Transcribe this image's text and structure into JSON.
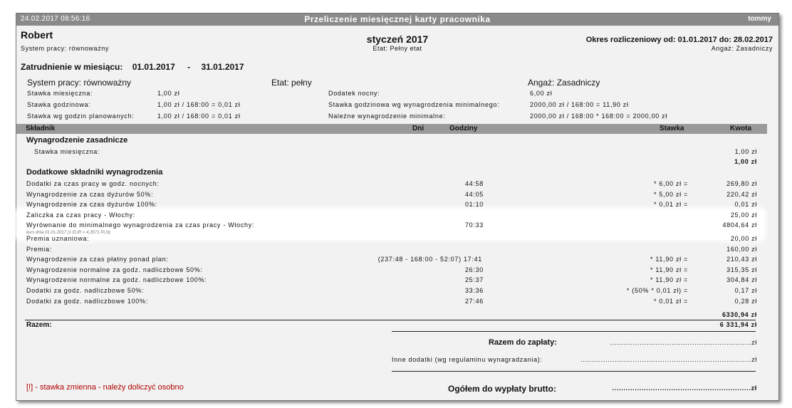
{
  "window": {
    "datetime": "24.02.2017  08:56:16",
    "title": "Przeliczenie miesięcznej karty pracownika",
    "user": "tommy"
  },
  "employee": {
    "name": "Robert",
    "system": "System pracy: równoważny",
    "month": "styczeń 2017",
    "etat": "Etat: Pełny etat",
    "period": "Okres rozliczeniowy od: 01.01.2017 do: 28.02.2017",
    "angaz": "Angaż: Zasadniczy"
  },
  "employment": {
    "label": "Zatrudnienie w miesiącu:",
    "from": "01.01.2017",
    "dash": "-",
    "to": "31.01.2017"
  },
  "params": {
    "system": "System pracy: równoważny",
    "etat": "Etat: pełny",
    "angaz": "Angaż: Zasadniczy",
    "stawka_mies_label": "Stawka miesięczna:",
    "stawka_mies_value": "1,00 zł",
    "stawka_godz_label": "Stawka godzinowa:",
    "stawka_godz_value": "1,00 zł / 168:00 = 0,01 zł",
    "stawka_plan_label": "Stawka wg godzin planowanych:",
    "stawka_plan_value": "1,00 zł / 168:00 = 0,01 zł",
    "dodatek_nocny_label": "Dodatek nocny:",
    "dodatek_nocny_value": "6,00 zł",
    "stawka_min_label": "Stawka godzinowa wg wynagrodzenia minimalnego:",
    "stawka_min_value": "2000,00 zł / 168:00 = 11,90 zł",
    "nalezne_min_label": "Należne wynagrodzenie minimalne:",
    "nalezne_min_value": "2000,00 zł / 168:00 * 168:00 = 2000,00 zł"
  },
  "table": {
    "headers": {
      "component": "Składnik",
      "days": "Dni",
      "hours": "Godziny",
      "rate": "Stawka",
      "amount": "Kwota"
    },
    "basic_title": "Wynagrodzenie zasadnicze",
    "basic_item_label": "Stawka miesięczna:",
    "basic_item_amount": "1,00 zł",
    "basic_total": "1,00 zł",
    "extra_title": "Dodatkowe składniki wynagrodzenia",
    "rows": [
      {
        "label": "Dodatki za czas pracy w godz. nocnych:",
        "hours": "44:58",
        "rate": "* 6,00 zł =",
        "amount": "269,80 zł"
      },
      {
        "label": "Wynagrodzenie za czas dyżurów 50%:",
        "hours": "44:05",
        "rate": "* 5,00 zł =",
        "amount": "220,42 zł"
      },
      {
        "label": "Wynagrodzenie za czas dyżurów 100%:",
        "hours": "01:10",
        "rate": "* 0,01 zł =",
        "amount": "0,01 zł"
      },
      {
        "label": "Zaliczka za czas pracy - Włochy:",
        "hours": "",
        "rate": "",
        "amount": "25,00 zł"
      },
      {
        "label": "Wyrównanie do minimalnego wynagrodzenia za czas pracy - Włochy:",
        "hours": "70:33",
        "rate": "",
        "amount": "4804,64 zł"
      },
      {
        "label": "Premia uznaniowa:",
        "hours": "",
        "rate": "",
        "amount": "20,00 zł"
      },
      {
        "label": "Premia:",
        "hours": "",
        "rate": "",
        "amount": "160,00 zł"
      },
      {
        "label": "Wynagrodzenie za czas płatny ponad plan:",
        "hours": "(237:48 - 168:00 - 52:07) 17:41",
        "rate": "* 11,90 zł =",
        "amount": "210,43 zł"
      },
      {
        "label": "Wynagrodzenie normalne za godz. nadliczbowe 50%:",
        "hours": "26:30",
        "rate": "* 11,90 zł =",
        "amount": "315,35 zł"
      },
      {
        "label": "Wynagrodzenie normalne za godz. nadliczbowe 100%:",
        "hours": "25:37",
        "rate": "* 11,90 zł =",
        "amount": "304,84 zł"
      },
      {
        "label": "Dodatki za godz. nadliczbowe 50%:",
        "hours": "33:36",
        "rate": "* (50% * 0,01 zł) =",
        "amount": "0,17 zł"
      },
      {
        "label": "Dodatki za godz. nadliczbowe 100%:",
        "hours": "27:46",
        "rate": "* 0,01 zł =",
        "amount": "0,28 zł"
      }
    ],
    "exchange_note": "kurs dnia 01.01.2017 (1 EUR = 4,3571 PLN)",
    "extra_total": "6330,94 zł"
  },
  "summary": {
    "razem_label": "Razem:",
    "razem_value": "6 331,94 zł",
    "do_zaplaty_label": "Razem do zapłaty:",
    "do_zaplaty_value": "..............................................................zł",
    "inne_label": "Inne dodatki (wg regulaminu wynagradzania):",
    "inne_value": "...........................................................................zł",
    "ogolem_label": "Ogółem do wypłaty brutto:",
    "ogolem_value": ".............................................................zł"
  },
  "note": "[!] - stawka zmienna - należy doliczyć osobno",
  "colors": {
    "titlebar": "#8a8a8a",
    "sheet": "#f2f2f2",
    "header_row": "#9a9a9a",
    "warning": "#b00000"
  }
}
